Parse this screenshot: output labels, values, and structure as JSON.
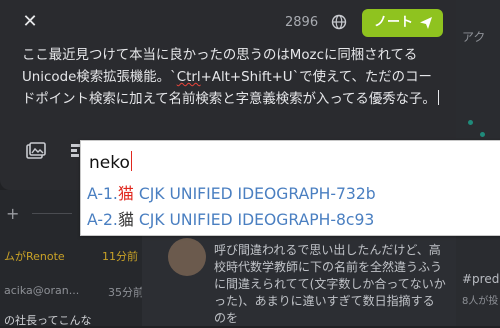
{
  "compose": {
    "char_count": "2896",
    "note_button_label": "ノート",
    "text_before_error": "ここ最近見つけて本当に良かったの思うのはMozcに同梱されてるUnicode検索拡張機能。`Ctrl+Alt+Shift+U`で使えて、ただの",
    "text_error_word": "Ctrl",
    "text_prefix": "ここ最近見つけて本当に良かったの思うのはMozcに同梱されてるUnicode検索拡張機能。`",
    "text_suffix": "+Alt+Shift+U`で使えて、ただのコードポイント検索に加えて名前検索と字意義検索が入ってる優秀な子。"
  },
  "ime": {
    "input": "neko",
    "candidates": [
      {
        "index": "A-1.",
        "glyph": "猫",
        "name": "CJK UNIFIED IDEOGRAPH-732b"
      },
      {
        "index": "A-2.",
        "glyph": "貓",
        "name": "CJK UNIFIED IDEOGRAPH-8c93"
      }
    ]
  },
  "background": {
    "right_column_header": "アク",
    "right_tag": "#pred",
    "right_tag_sub": "8人が投",
    "renote_text": "ムがRenote",
    "renote_time": "11分前",
    "user_handle": "acika@oran...",
    "user_time": "35分前",
    "bottom_text": "の社長ってこんな",
    "mid_text": "呼び間違われるで思い出したんだけど、高校時代数学教師に下の名前を全然違うふうに間違えられてて(文字数しか合ってないかった)、あまりに違いすぎて数日指摘するのを"
  },
  "colors": {
    "accent": "#8fc31f",
    "candidate_text": "#4a7fc1",
    "highlight_glyph": "#e0281e",
    "panel_bg": "#2a2b2f"
  },
  "icons": {
    "close": "close-icon",
    "globe": "globe-icon",
    "send": "send-icon",
    "image": "image-icon",
    "poll": "poll-icon"
  }
}
